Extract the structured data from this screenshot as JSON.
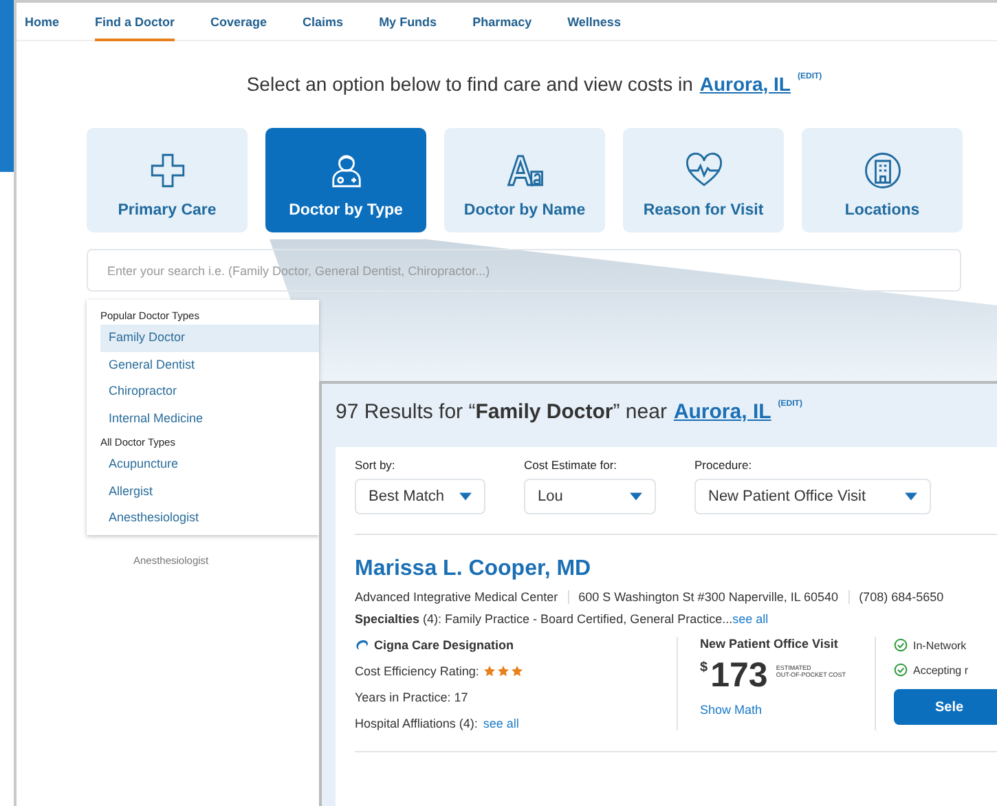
{
  "nav": {
    "items": [
      {
        "label": "Home",
        "selected": false
      },
      {
        "label": "Find a Doctor",
        "selected": true
      },
      {
        "label": "Coverage",
        "selected": false
      },
      {
        "label": "Claims",
        "selected": false
      },
      {
        "label": "My Funds",
        "selected": false
      },
      {
        "label": "Pharmacy",
        "selected": false
      },
      {
        "label": "Wellness",
        "selected": false
      }
    ]
  },
  "prompt": {
    "text": "Select an option below to find care and view costs in",
    "location": "Aurora, IL",
    "edit": "(EDIT)"
  },
  "options": [
    {
      "label": "Primary Care",
      "kind": "cross",
      "selected": false
    },
    {
      "label": "Doctor by Type",
      "kind": "doctor",
      "selected": true
    },
    {
      "label": "Doctor by Name",
      "kind": "letters",
      "selected": false
    },
    {
      "label": "Reason for Visit",
      "kind": "heart",
      "selected": false
    },
    {
      "label": "Locations",
      "kind": "building",
      "selected": false
    }
  ],
  "search": {
    "placeholder": "Enter your search i.e. (Family Doctor, General Dentist, Chiropractor...)"
  },
  "dropdown": {
    "groups": [
      {
        "heading": "Popular Doctor Types",
        "items": [
          {
            "label": "Family Doctor",
            "selected": true
          },
          {
            "label": "General Dentist",
            "selected": false
          },
          {
            "label": "Chiropractor",
            "selected": false
          },
          {
            "label": "Internal Medicine",
            "selected": false
          }
        ]
      },
      {
        "heading": "All Doctor Types",
        "items": [
          {
            "label": "Acupuncture",
            "selected": false
          },
          {
            "label": "Allergist",
            "selected": false
          },
          {
            "label": "Anesthesiologist",
            "selected": false
          }
        ]
      }
    ],
    "ghost_text": "Anesthesiologist"
  },
  "results": {
    "heading": "97 Results for “**Family Doctor**” near",
    "location": "Aurora, IL",
    "edit": "(EDIT)",
    "filters": [
      {
        "label": "Sort by:",
        "value": "Best Match"
      },
      {
        "label": "Cost Estimate for:",
        "value": "Lou"
      },
      {
        "label": "Procedure:",
        "value": "New Patient Office Visit"
      }
    ],
    "provider": {
      "name": "Marissa L. Cooper, MD",
      "details": [
        "Advanced Integrative Medical Center",
        "600 S Washington St #300 Naperville, IL 60540",
        "(708) 684-5650"
      ],
      "specialties": "**Specialties** (4): Family Practice - Board Certified, General Practice...",
      "specialties_link": "see all",
      "designation": "Cigna Care Designation",
      "rating_label": "Cost Efficiency Rating:",
      "stars": 3,
      "years": "Years in Practice: 17",
      "hospitals": "Hospital Affliations (4):",
      "hospitals_link": "see all",
      "cost": {
        "title": "New Patient Office Visit",
        "currency": "$",
        "amount": "173",
        "note": [
          "ESTIMATED",
          "OUT-OF-POCKET COST"
        ],
        "link": "Show Math"
      },
      "status": [
        {
          "label": "In-Network",
          "checked": true
        },
        {
          "label": "Accepting r",
          "checked": true
        }
      ],
      "button": "Sele"
    }
  }
}
